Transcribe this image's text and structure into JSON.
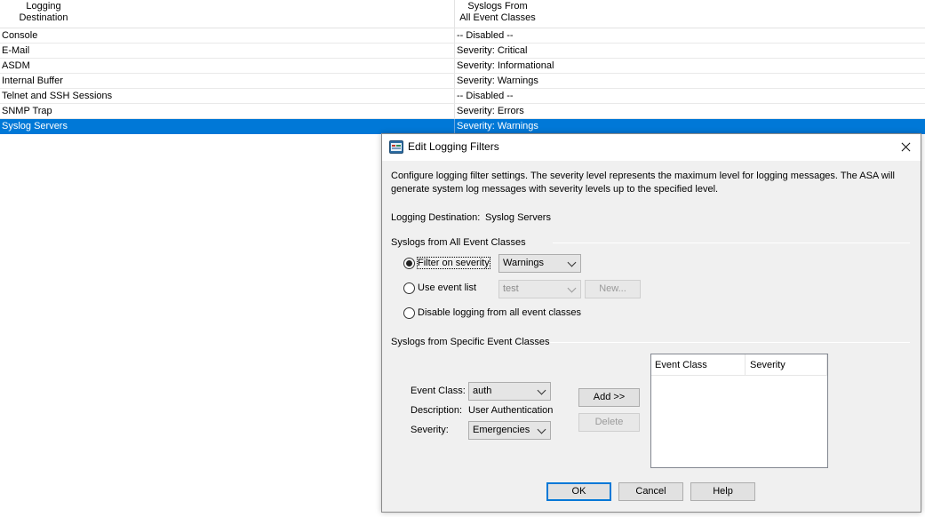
{
  "table": {
    "header": {
      "col1_line1": "Logging",
      "col1_line2": "Destination",
      "col2_line1": "Syslogs From",
      "col2_line2": "All Event Classes"
    },
    "rows": [
      {
        "destination": "Console",
        "syslogs": "-- Disabled --"
      },
      {
        "destination": "E-Mail",
        "syslogs": "Severity: Critical"
      },
      {
        "destination": "ASDM",
        "syslogs": "Severity: Informational"
      },
      {
        "destination": "Internal Buffer",
        "syslogs": "Severity: Warnings"
      },
      {
        "destination": "Telnet and SSH Sessions",
        "syslogs": "-- Disabled --"
      },
      {
        "destination": "SNMP Trap",
        "syslogs": "Severity: Errors"
      },
      {
        "destination": "Syslog Servers",
        "syslogs": "Severity: Warnings"
      }
    ],
    "selected_row_color": "#0078d7"
  },
  "dialog": {
    "title": "Edit Logging Filters",
    "icon": "asdm-app-icon",
    "description": "Configure logging filter settings. The severity level represents the maximum level for logging messages. The ASA will generate system log messages with severity levels up to the specified level.",
    "destination_label": "Logging Destination:",
    "destination_value": "Syslog Servers",
    "all_classes_group": "Syslogs from All Event Classes",
    "filter_on_severity_label": "Filter on severity",
    "severity_select_value": "Warnings",
    "use_event_list_label": "Use event list",
    "event_list_select_value": "test",
    "new_button": "New...",
    "disable_logging_label": "Disable logging from all event classes",
    "specific_classes_group": "Syslogs from Specific Event Classes",
    "event_class_label": "Event Class:",
    "event_class_value": "auth",
    "description_label": "Description:",
    "description_value": "User Authentication",
    "severity_label": "Severity:",
    "severity_value": "Emergencies",
    "add_button": "Add >>",
    "delete_button": "Delete",
    "list_headers": [
      "Event Class",
      "Severity"
    ],
    "ok_button": "OK",
    "cancel_button": "Cancel",
    "help_button": "Help",
    "selected_radio": "filter_on_severity"
  }
}
